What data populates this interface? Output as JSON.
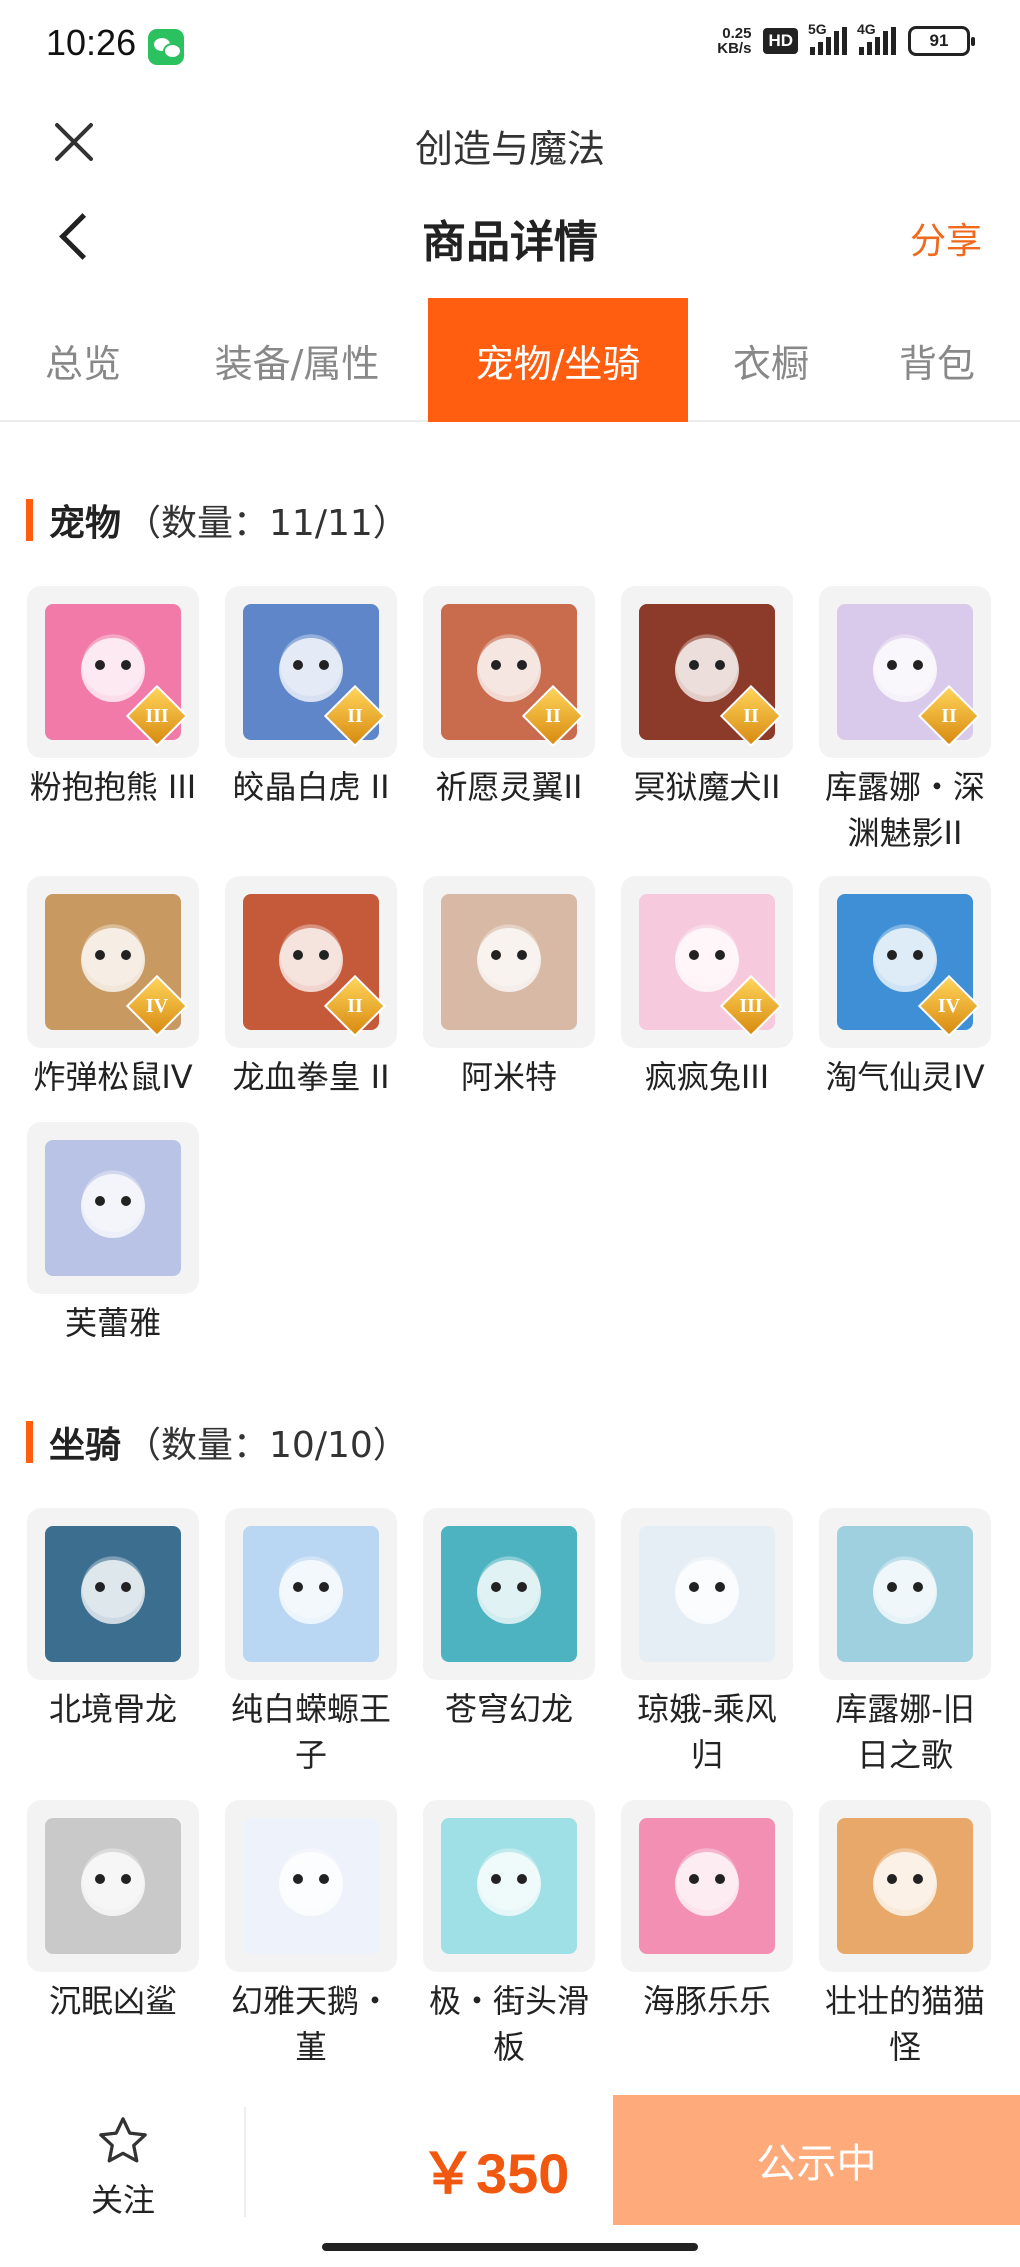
{
  "status_bar": {
    "time": "10:26",
    "speed_value": "0.25",
    "speed_unit": "KB/s",
    "hd_label": "HD",
    "net1": "5G",
    "net2": "4G",
    "battery": "91"
  },
  "app": {
    "title": "创造与魔法"
  },
  "header": {
    "title": "商品详情",
    "share": "分享"
  },
  "tabs": [
    {
      "label": "总览",
      "active": false
    },
    {
      "label": "装备/属性",
      "active": false
    },
    {
      "label": "宠物/坐骑",
      "active": true
    },
    {
      "label": "衣橱",
      "active": false
    },
    {
      "label": "背包",
      "active": false
    }
  ],
  "pets": {
    "title": "宠物",
    "count": "（数量：11/11）",
    "items": [
      {
        "name": "粉抱抱熊 III",
        "rank": "III",
        "color": "#f27aa8"
      },
      {
        "name": "皎晶白虎 II",
        "rank": "II",
        "color": "#5f86c9"
      },
      {
        "name": "祈愿灵翼II",
        "rank": "II",
        "color": "#c96b4d"
      },
      {
        "name": "冥狱魔犬II",
        "rank": "II",
        "color": "#8c3a2a"
      },
      {
        "name": "库露娜・深渊魅影II",
        "rank": "II",
        "color": "#d9c9ea"
      },
      {
        "name": "炸弹松鼠IV",
        "rank": "IV",
        "color": "#c89a62"
      },
      {
        "name": "龙血拳皇 II",
        "rank": "II",
        "color": "#c55a3a"
      },
      {
        "name": "阿米特",
        "rank": "",
        "color": "#d8b9a6"
      },
      {
        "name": "疯疯兔III",
        "rank": "III",
        "color": "#f6c9dc"
      },
      {
        "name": "淘气仙灵IV",
        "rank": "IV",
        "color": "#3e8fd6"
      },
      {
        "name": "芙蕾雅",
        "rank": "",
        "color": "#b9c3e6"
      }
    ]
  },
  "mounts": {
    "title": "坐骑",
    "count": "（数量：10/10）",
    "items": [
      {
        "name": "北境骨龙",
        "color": "#3c6e8f"
      },
      {
        "name": "纯白蝾螈王子",
        "color": "#b9d6f2"
      },
      {
        "name": "苍穹幻龙",
        "color": "#4db3c1"
      },
      {
        "name": "琼娥-乘风归",
        "color": "#e6eef5"
      },
      {
        "name": "库露娜-旧日之歌",
        "color": "#9fd0e0"
      },
      {
        "name": "沉眠凶鲨",
        "color": "#c9c9c9"
      },
      {
        "name": "幻雅天鹅・堇",
        "color": "#eef2fb"
      },
      {
        "name": "极・街头滑板",
        "color": "#9fe0e6"
      },
      {
        "name": "海豚乐乐",
        "color": "#f28fb2"
      },
      {
        "name": "壮壮的猫猫怪",
        "color": "#e8a86a"
      }
    ]
  },
  "bottom": {
    "follow": "关注",
    "price": "￥350",
    "cta": "公示中",
    "accent": "#ff5d0f"
  }
}
